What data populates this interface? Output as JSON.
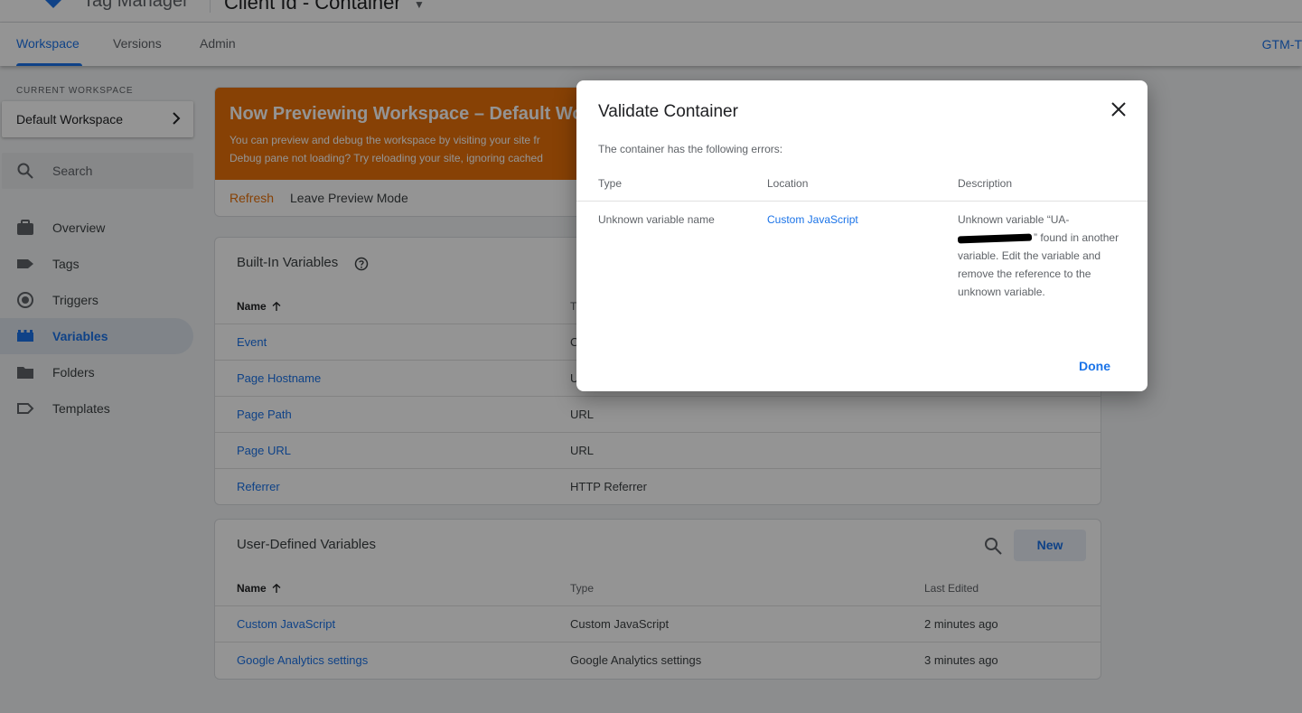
{
  "app": {
    "product_name": "Tag Manager",
    "container_name": "Client Id - Container",
    "container_id": "GTM-T"
  },
  "tabs": [
    {
      "label": "Workspace",
      "active": true
    },
    {
      "label": "Versions",
      "active": false
    },
    {
      "label": "Admin",
      "active": false
    }
  ],
  "sidebar": {
    "current_workspace_label": "CURRENT WORKSPACE",
    "workspace_name": "Default Workspace",
    "search_placeholder": "Search",
    "items": [
      {
        "label": "Overview",
        "icon": "briefcase-icon",
        "active": false
      },
      {
        "label": "Tags",
        "icon": "tag-icon",
        "active": false
      },
      {
        "label": "Triggers",
        "icon": "trigger-icon",
        "active": false
      },
      {
        "label": "Variables",
        "icon": "variables-icon",
        "active": true
      },
      {
        "label": "Folders",
        "icon": "folder-icon",
        "active": false
      },
      {
        "label": "Templates",
        "icon": "template-icon",
        "active": false
      }
    ]
  },
  "preview": {
    "title": "Now Previewing Workspace – Default Work",
    "line1": "You can preview and debug the workspace by visiting your site fr",
    "line2": "Debug pane not loading? Try reloading your site, ignoring cached",
    "refresh_label": "Refresh",
    "leave_label": "Leave Preview Mode",
    "banner_color": "#e8710a"
  },
  "builtin_variables": {
    "title": "Built-In Variables",
    "col_name": "Name",
    "col_type": "T",
    "rows": [
      {
        "name": "Event",
        "type": "C"
      },
      {
        "name": "Page Hostname",
        "type": "U"
      },
      {
        "name": "Page Path",
        "type": "URL"
      },
      {
        "name": "Page URL",
        "type": "URL"
      },
      {
        "name": "Referrer",
        "type": "HTTP Referrer"
      }
    ]
  },
  "user_defined_variables": {
    "title": "User-Defined Variables",
    "new_label": "New",
    "col_name": "Name",
    "col_type": "Type",
    "col_edited": "Last Edited",
    "rows": [
      {
        "name": "Custom JavaScript",
        "type": "Custom JavaScript",
        "edited": "2 minutes ago"
      },
      {
        "name": "Google Analytics settings",
        "type": "Google Analytics settings",
        "edited": "3 minutes ago"
      }
    ]
  },
  "dialog": {
    "title": "Validate Container",
    "subtitle": "The container has the following errors:",
    "col_type": "Type",
    "col_location": "Location",
    "col_description": "Description",
    "error": {
      "type": "Unknown variable name",
      "location": "Custom JavaScript",
      "desc_start": "Unknown variable “UA-",
      "desc_end": "” found in another variable. Edit the variable and remove the reference to the unknown variable."
    },
    "done_label": "Done"
  },
  "colors": {
    "accent": "#1a73e8",
    "preview_orange": "#e8710a"
  }
}
